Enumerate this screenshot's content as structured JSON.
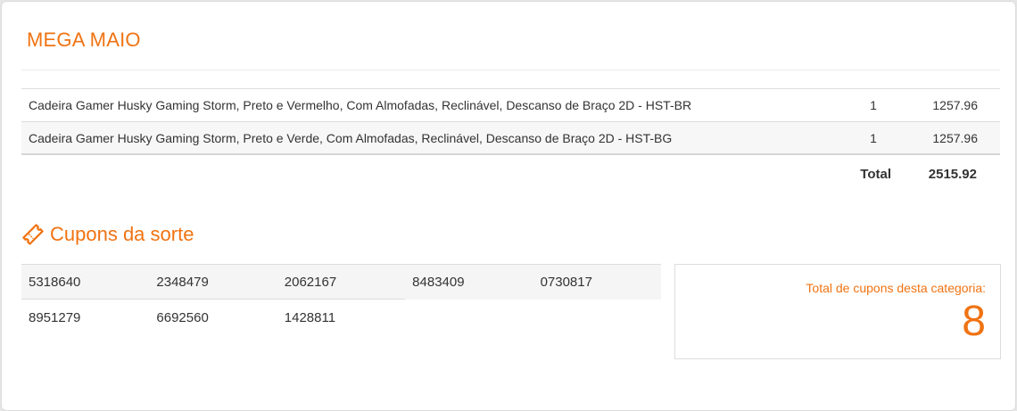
{
  "section_title": "MEGA MAIO",
  "items": [
    {
      "name": "Cadeira Gamer Husky Gaming Storm, Preto e Vermelho, Com Almofadas, Reclinável, Descanso de Braço 2D - HST-BR",
      "qty": "1",
      "price": "1257.96"
    },
    {
      "name": "Cadeira Gamer Husky Gaming Storm, Preto e Verde, Com Almofadas, Reclinável, Descanso de Braço 2D - HST-BG",
      "qty": "1",
      "price": "1257.96"
    }
  ],
  "total": {
    "label": "Total",
    "value": "2515.92"
  },
  "coupons": {
    "heading": "Cupons da sorte",
    "icon": "ticket-icon",
    "codes_row1": [
      "5318640",
      "2348479",
      "2062167",
      "8483409",
      "0730817"
    ],
    "codes_row2": [
      "8951279",
      "6692560",
      "1428811"
    ],
    "summary_label": "Total de cupons desta categoria:",
    "summary_count": "8"
  },
  "colors": {
    "accent": "#f07312"
  }
}
